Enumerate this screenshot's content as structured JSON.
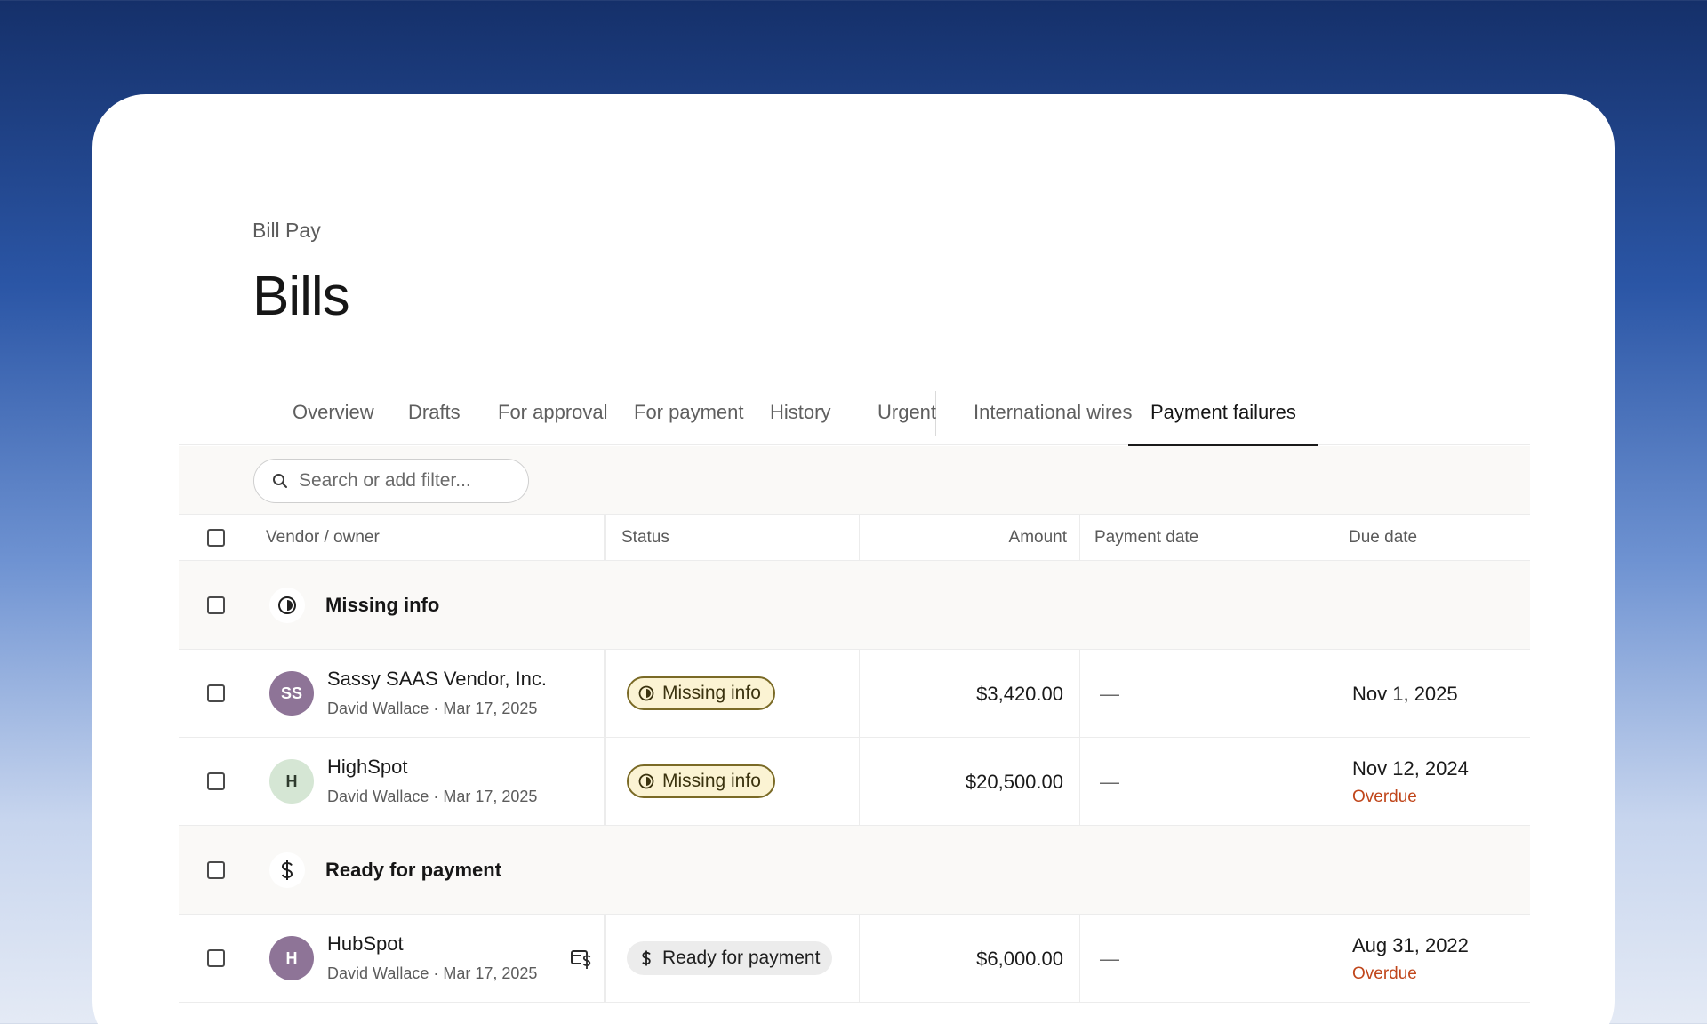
{
  "breadcrumb": "Bill Pay",
  "title": "Bills",
  "tabs": [
    {
      "label": "Overview"
    },
    {
      "label": "Drafts"
    },
    {
      "label": "For approval"
    },
    {
      "label": "For payment"
    },
    {
      "label": "History"
    },
    {
      "label": "Urgent"
    },
    {
      "label": "International wires"
    },
    {
      "label": "Payment failures",
      "active": true
    }
  ],
  "search": {
    "placeholder": "Search or add filter..."
  },
  "columns": {
    "vendor": "Vendor / owner",
    "status": "Status",
    "amount": "Amount",
    "payment_date": "Payment date",
    "due_date": "Due date"
  },
  "groups": [
    {
      "title": "Missing info",
      "icon": "half-circle-icon",
      "bills": [
        {
          "initials": "SS",
          "avatar_bg": "#8e7497",
          "avatar_fg": "#ffffff",
          "vendor": "Sassy SAAS Vendor, Inc.",
          "meta": "David Wallace · Mar 17, 2025",
          "status": "Missing info",
          "amount": "$3,420.00",
          "payment_date": "—",
          "due_date": "Nov 1, 2025",
          "overdue": ""
        },
        {
          "initials": "H",
          "avatar_bg": "#d5e6d4",
          "avatar_fg": "#2e3a2d",
          "vendor": "HighSpot",
          "meta": "David Wallace · Mar 17, 2025",
          "status": "Missing info",
          "amount": "$20,500.00",
          "payment_date": "—",
          "due_date": "Nov 12, 2024",
          "overdue": "Overdue"
        }
      ]
    },
    {
      "title": "Ready for payment",
      "icon": "dollar-icon",
      "bills": [
        {
          "initials": "H",
          "avatar_bg": "#8e7497",
          "avatar_fg": "#ffffff",
          "vendor": "HubSpot",
          "meta": "David Wallace · Mar 17, 2025",
          "status": "Ready for payment",
          "amount": "$6,000.00",
          "payment_date": "—",
          "due_date": "Aug 31, 2022",
          "overdue": "Overdue"
        }
      ]
    }
  ],
  "colors": {
    "overdue": "#c0461b",
    "missing_pill_bg": "#fbf3d3",
    "ready_pill_bg": "#ececec"
  }
}
